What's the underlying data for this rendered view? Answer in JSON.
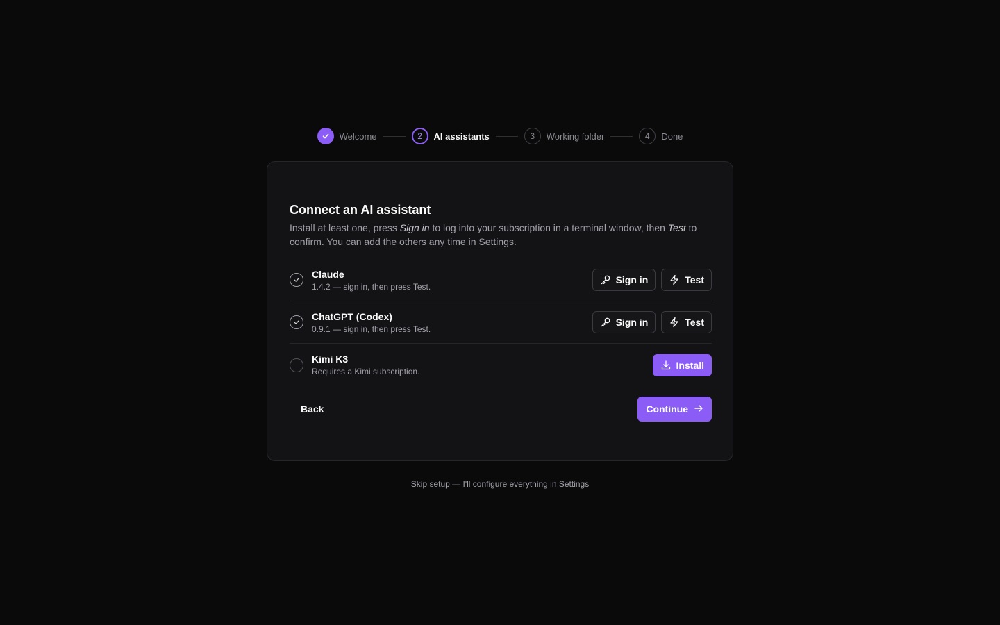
{
  "stepper": {
    "steps": [
      {
        "number": "",
        "label": "Welcome",
        "state": "done"
      },
      {
        "number": "2",
        "label": "AI assistants",
        "state": "active"
      },
      {
        "number": "3",
        "label": "Working folder",
        "state": "todo"
      },
      {
        "number": "4",
        "label": "Done",
        "state": "todo"
      }
    ]
  },
  "card": {
    "title": "Connect an AI assistant",
    "desc_part1": "Install at least one, press ",
    "desc_em1": "Sign in",
    "desc_part2": " to log into your subscription in a terminal window, then ",
    "desc_em2": "Test",
    "desc_part3": " to confirm. You can add the others any time in Settings."
  },
  "providers": [
    {
      "name": "Claude",
      "sub": "1.4.2 — sign in, then press Test.",
      "status": "check-circle-icon",
      "signin_label": "Sign in",
      "test_label": "Test"
    },
    {
      "name": "ChatGPT (Codex)",
      "sub": "0.9.1 — sign in, then press Test.",
      "status": "check-circle-icon",
      "signin_label": "Sign in",
      "test_label": "Test"
    },
    {
      "name": "Kimi K3",
      "sub": "Requires a Kimi subscription.",
      "status": "empty-circle-icon",
      "install_label": "Install"
    }
  ],
  "footer": {
    "back_label": "Back",
    "continue_label": "Continue"
  },
  "skip_label": "Skip setup — I'll configure everything in Settings",
  "colors": {
    "accent": "#8b5cf6",
    "background": "#0a0a0b",
    "card": "#131315"
  }
}
